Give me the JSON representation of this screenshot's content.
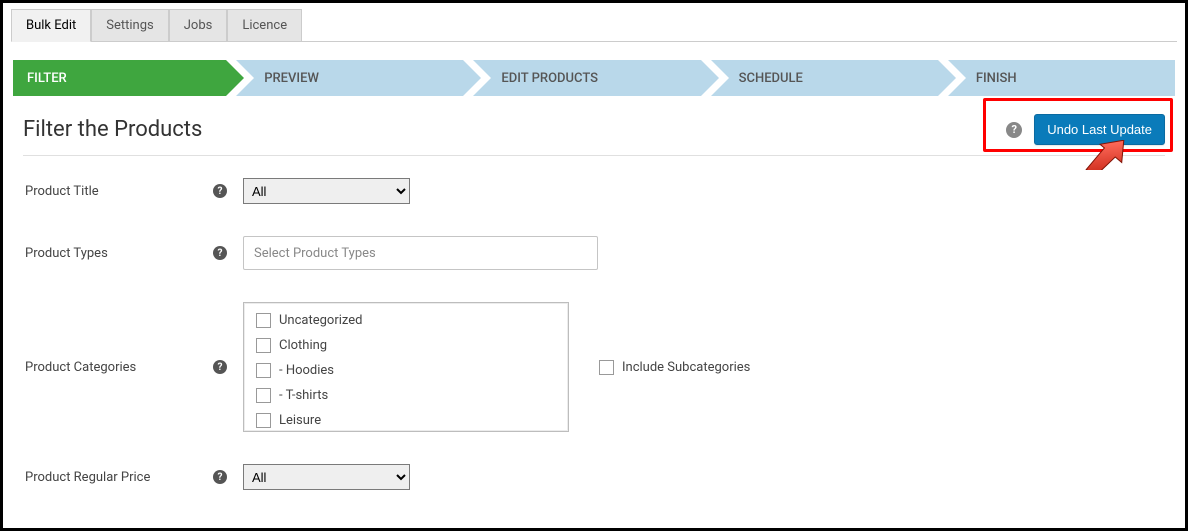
{
  "tabs": [
    {
      "label": "Bulk Edit",
      "active": true
    },
    {
      "label": "Settings",
      "active": false
    },
    {
      "label": "Jobs",
      "active": false
    },
    {
      "label": "Licence",
      "active": false
    }
  ],
  "wizard": [
    {
      "label": "FILTER",
      "active": true
    },
    {
      "label": "PREVIEW",
      "active": false
    },
    {
      "label": "EDIT PRODUCTS",
      "active": false
    },
    {
      "label": "SCHEDULE",
      "active": false
    },
    {
      "label": "FINISH",
      "active": false
    }
  ],
  "heading": "Filter the Products",
  "undo_button": "Undo Last Update",
  "fields": {
    "product_title": {
      "label": "Product Title",
      "selected": "All"
    },
    "product_types": {
      "label": "Product Types",
      "placeholder": "Select Product Types"
    },
    "product_categories": {
      "label": "Product Categories",
      "options": [
        "Uncategorized",
        "Clothing",
        "- Hoodies",
        "- T-shirts",
        "Leisure"
      ],
      "include_sub": "Include Subcategories"
    },
    "product_regular_price": {
      "label": "Product Regular Price",
      "selected": "All"
    }
  }
}
